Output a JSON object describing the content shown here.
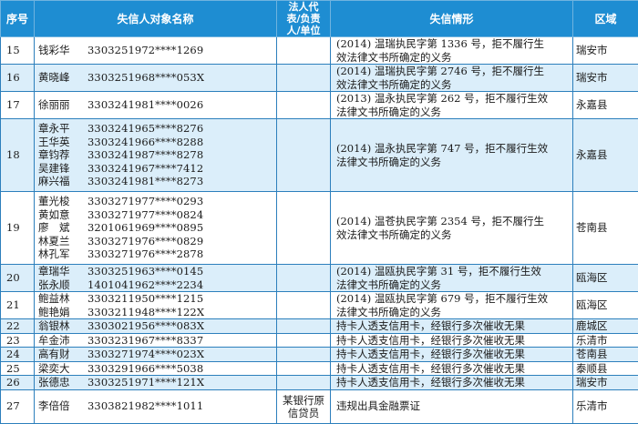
{
  "headers": {
    "no": "序号",
    "name": "失信人对象名称",
    "rep": [
      "法人代",
      "表/负责",
      "人/单位"
    ],
    "detail": "失信情形",
    "area": "区域"
  },
  "rows": [
    {
      "no": "15",
      "people": [
        {
          "name": "钱彩华",
          "id": "3303251972****1269"
        }
      ],
      "rep": [],
      "detail": [
        "(2014) 温瑞执民字第 1336 号，拒不履行生",
        "效法律文书所确定的义务"
      ],
      "area": "瑞安市"
    },
    {
      "no": "16",
      "people": [
        {
          "name": "黄晓峰",
          "id": "3303251968****053X"
        }
      ],
      "rep": [],
      "detail": [
        "(2014) 温瑞执民字第 2746 号，拒不履行生",
        "效法律文书所确定的义务"
      ],
      "area": "瑞安市"
    },
    {
      "no": "17",
      "people": [
        {
          "name": "徐丽丽",
          "id": "3303241981****0026"
        }
      ],
      "rep": [],
      "detail": [
        "(2013) 温永执民字第 262 号，拒不履行生效",
        "法律文书所确定的义务"
      ],
      "area": "永嘉县"
    },
    {
      "no": "18",
      "people": [
        {
          "name": "章永平",
          "id": "3303241965****8276"
        },
        {
          "name": "王华英",
          "id": "3303241966****8288"
        },
        {
          "name": "章钧荐",
          "id": "3303241987****8278"
        },
        {
          "name": "吴建锋",
          "id": "3303241967****7412"
        },
        {
          "name": "麻兴福",
          "id": "3303241981****8273"
        }
      ],
      "rep": [],
      "detail": [
        "(2014) 温永执民字第 747 号，拒不履行生效",
        "法律文书所确定的义务"
      ],
      "area": "永嘉县"
    },
    {
      "no": "19",
      "people": [
        {
          "name": "董光梭",
          "id": "3303271977****0293"
        },
        {
          "name": "黄如意",
          "id": "3303271977****0824"
        },
        {
          "name": "廖　斌",
          "id": "3201061969****0895"
        },
        {
          "name": "林夏兰",
          "id": "3303271976****0829"
        },
        {
          "name": "林孔军",
          "id": "3303271976****2878"
        }
      ],
      "rep": [],
      "detail": [
        "(2014) 温苍执民字第 2354 号，拒不履行生",
        "效法律文书所确定的义务"
      ],
      "area": "苍南县"
    },
    {
      "no": "20",
      "people": [
        {
          "name": "章瑞华",
          "id": "3303251963****0145"
        },
        {
          "name": "张永顺",
          "id": "1401041962****2234"
        }
      ],
      "rep": [],
      "detail": [
        "(2014) 温瓯执民字第 31 号，拒不履行生效",
        "法律文书所确定的义务"
      ],
      "area": "瓯海区"
    },
    {
      "no": "21",
      "people": [
        {
          "name": "鲍益林",
          "id": "3303211950****1215"
        },
        {
          "name": "鲍艳娟",
          "id": "3303211948****122X"
        }
      ],
      "rep": [],
      "detail": [
        "(2014) 温瓯执民字第 679 号，拒不履行生效",
        "法律文书所确定的义务"
      ],
      "area": "瓯海区"
    },
    {
      "no": "22",
      "people": [
        {
          "name": "翁银林",
          "id": "3303021956****083X"
        }
      ],
      "rep": [],
      "detail": [
        "持卡人透支信用卡，经银行多次催收无果"
      ],
      "area": "鹿城区"
    },
    {
      "no": "23",
      "people": [
        {
          "name": "牟金沛",
          "id": "3303231967****8337"
        }
      ],
      "rep": [],
      "detail": [
        "持卡人透支信用卡，经银行多次催收无果"
      ],
      "area": "乐清市"
    },
    {
      "no": "24",
      "people": [
        {
          "name": "高有财",
          "id": "3303271974****023X"
        }
      ],
      "rep": [],
      "detail": [
        "持卡人透支信用卡，经银行多次催收无果"
      ],
      "area": "苍南县"
    },
    {
      "no": "25",
      "people": [
        {
          "name": "梁奕大",
          "id": "3303291966****5038"
        }
      ],
      "rep": [],
      "detail": [
        "持卡人透支信用卡，经银行多次催收无果"
      ],
      "area": "泰顺县"
    },
    {
      "no": "26",
      "people": [
        {
          "name": "张德忠",
          "id": "3303251971****121X"
        }
      ],
      "rep": [],
      "detail": [
        "持卡人透支信用卡，经银行多次催收无果"
      ],
      "area": "瑞安市"
    },
    {
      "no": "27",
      "people": [
        {
          "name": "李倍倍",
          "id": "3303821982****1011"
        }
      ],
      "rep": [
        "某银行原",
        "信贷员"
      ],
      "detail": [
        "违规出具金融票证"
      ],
      "area": "乐清市"
    }
  ]
}
